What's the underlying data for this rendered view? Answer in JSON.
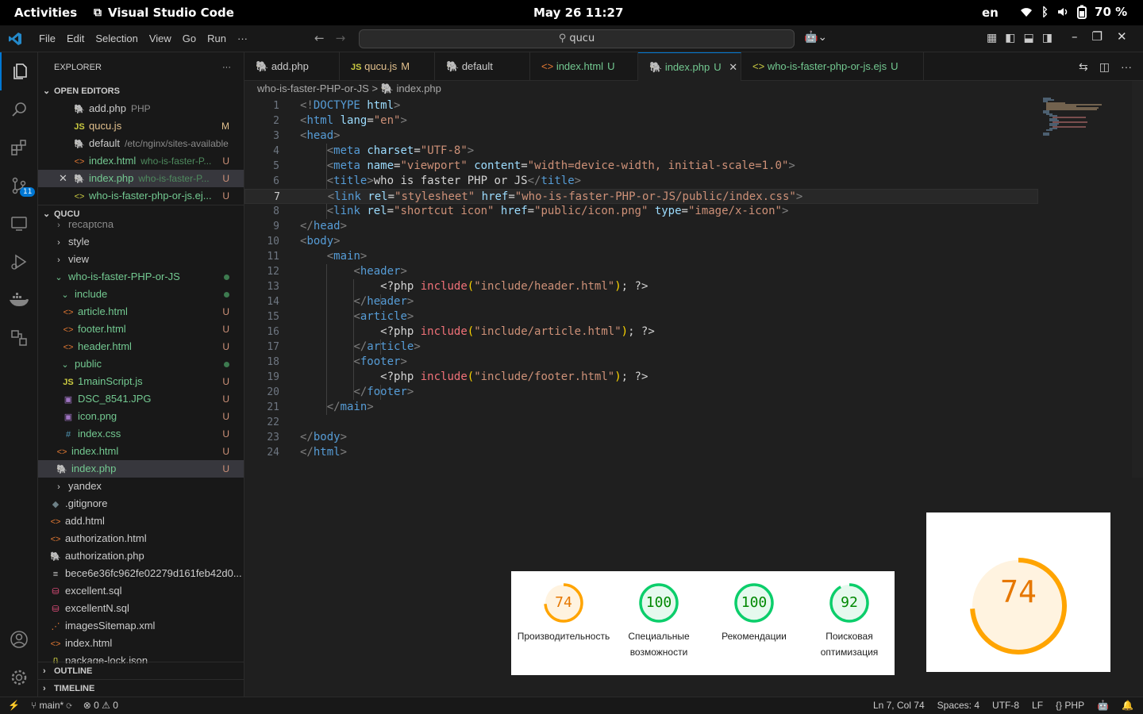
{
  "system": {
    "activities": "Activities",
    "app": "Visual Studio Code",
    "clock": "May 26  11:27",
    "lang": "en",
    "battery": "70 %"
  },
  "menu": [
    "File",
    "Edit",
    "Selection",
    "View",
    "Go",
    "Run",
    "···"
  ],
  "search": {
    "value": "qucu"
  },
  "explorer": {
    "title": "EXPLORER",
    "open_editors_label": "OPEN EDITORS",
    "open_editors": [
      {
        "name": "add.php",
        "desc": "PHP",
        "status": ""
      },
      {
        "name": "qucu.js",
        "desc": "",
        "status": "M"
      },
      {
        "name": "default",
        "desc": "/etc/nginx/sites-available",
        "status": ""
      },
      {
        "name": "index.html",
        "desc": "who-is-faster-P...",
        "status": "U"
      },
      {
        "name": "index.php",
        "desc": "who-is-faster-P...",
        "status": "U"
      },
      {
        "name": "who-is-faster-php-or-js.ej...",
        "desc": "",
        "status": "U"
      }
    ],
    "folder_label": "QUCU",
    "tree": [
      {
        "name": "recaptcha",
        "status": ""
      },
      {
        "name": "style",
        "status": ""
      },
      {
        "name": "view",
        "status": ""
      },
      {
        "name": "who-is-faster-PHP-or-JS",
        "status": ""
      },
      {
        "name": "include",
        "status": ""
      },
      {
        "name": "article.html",
        "status": "U"
      },
      {
        "name": "footer.html",
        "status": "U"
      },
      {
        "name": "header.html",
        "status": "U"
      },
      {
        "name": "public",
        "status": ""
      },
      {
        "name": "1mainScript.js",
        "status": "U"
      },
      {
        "name": "DSC_8541.JPG",
        "status": "U"
      },
      {
        "name": "icon.png",
        "status": "U"
      },
      {
        "name": "index.css",
        "status": "U"
      },
      {
        "name": "index.html",
        "status": "U"
      },
      {
        "name": "index.php",
        "status": "U"
      },
      {
        "name": "yandex",
        "status": ""
      },
      {
        "name": ".gitignore",
        "status": ""
      },
      {
        "name": "add.html",
        "status": ""
      },
      {
        "name": "authorization.html",
        "status": ""
      },
      {
        "name": "authorization.php",
        "status": ""
      },
      {
        "name": "bece6e36fc962fe02279d161feb42d0...",
        "status": ""
      },
      {
        "name": "excellent.sql",
        "status": ""
      },
      {
        "name": "excellentN.sql",
        "status": ""
      },
      {
        "name": "imagesSitemap.xml",
        "status": ""
      },
      {
        "name": "index.html",
        "status": ""
      },
      {
        "name": "package-lock.json",
        "status": ""
      }
    ],
    "outline_label": "OUTLINE",
    "timeline_label": "TIMELINE"
  },
  "tabs": [
    {
      "name": "add.php",
      "status": ""
    },
    {
      "name": "qucu.js",
      "status": "M"
    },
    {
      "name": "default",
      "status": ""
    },
    {
      "name": "index.html",
      "status": "U"
    },
    {
      "name": "index.php",
      "status": "U"
    },
    {
      "name": "who-is-faster-php-or-js.ejs",
      "status": "U"
    }
  ],
  "breadcrumb": {
    "folder": "who-is-faster-PHP-or-JS",
    "sep": ">",
    "file": "index.php"
  },
  "code_lines": [
    "1",
    "2",
    "3",
    "4",
    "5",
    "6",
    "7",
    "8",
    "9",
    "10",
    "11",
    "12",
    "13",
    "14",
    "15",
    "16",
    "17",
    "18",
    "19",
    "20",
    "21",
    "22",
    "23",
    "24"
  ],
  "code": {
    "l1a": "<!",
    "l1b": "DOCTYPE",
    "l1c": " html",
    ">": ">",
    "l2_lang": "lang",
    "l2_en": "\"en\"",
    "charset": "charset",
    "utf8": "\"UTF-8\"",
    "name": "name",
    "viewport": "\"viewport\"",
    "content": "content",
    "content_val": "\"width=device-width, initial-scale=1.0\"",
    "title_text": "who is faster PHP or JS",
    "rel": "rel",
    "stylesheet": "\"stylesheet\"",
    "href": "href",
    "css_href": "\"who-is-faster-PHP-or-JS/public/index.css\"",
    "shortcut": "\"shortcut icon\"",
    "icon_href": "\"public/icon.png\"",
    "type": "type",
    "icon_type": "\"image/x-icon\"",
    "php_open": "<?php",
    "include": "include",
    "inc_header": "\"include/header.html\"",
    "inc_article": "\"include/article.html\"",
    "inc_footer": "\"include/footer.html\"",
    "php_close": "; ?>",
    "html": "html",
    "head": "head",
    "meta": "meta",
    "title": "title",
    "link": "link",
    "body": "body",
    "main": "main",
    "header": "header",
    "article": "article",
    "footer": "footer"
  },
  "statusbar": {
    "branch": "main*",
    "errors": "0",
    "warnings": "0",
    "position": "Ln 7, Col 74",
    "spaces": "Spaces: 4",
    "encoding": "UTF-8",
    "eol": "LF",
    "language": "PHP"
  },
  "lighthouse": {
    "scores": [
      {
        "value": "74",
        "label": "Производительность",
        "fraction": 0.74,
        "color": "#ffa400"
      },
      {
        "value": "100",
        "label": "Специальные возможности",
        "fraction": 1.0,
        "color": "#0cce6b"
      },
      {
        "value": "100",
        "label": "Рекомендации",
        "fraction": 1.0,
        "color": "#0cce6b"
      },
      {
        "value": "92",
        "label": "Поисковая оптимизация",
        "fraction": 0.92,
        "color": "#0cce6b"
      }
    ],
    "big_value": "74",
    "big_fraction": 0.74
  }
}
